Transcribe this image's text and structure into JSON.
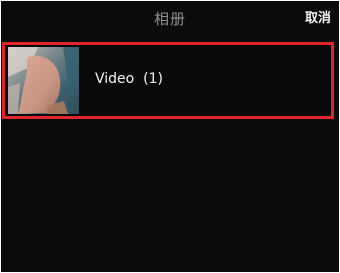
{
  "header": {
    "title": "相册",
    "cancel_label": "取消"
  },
  "albums": [
    {
      "label": "Video  (1)",
      "thumbnail_icon": "video-thumbnail-icon"
    }
  ],
  "colors": {
    "background": "#0b0b0b",
    "highlight_border": "#e0262d",
    "title_text": "#8f8f8f",
    "primary_text": "#f4f4f4"
  }
}
